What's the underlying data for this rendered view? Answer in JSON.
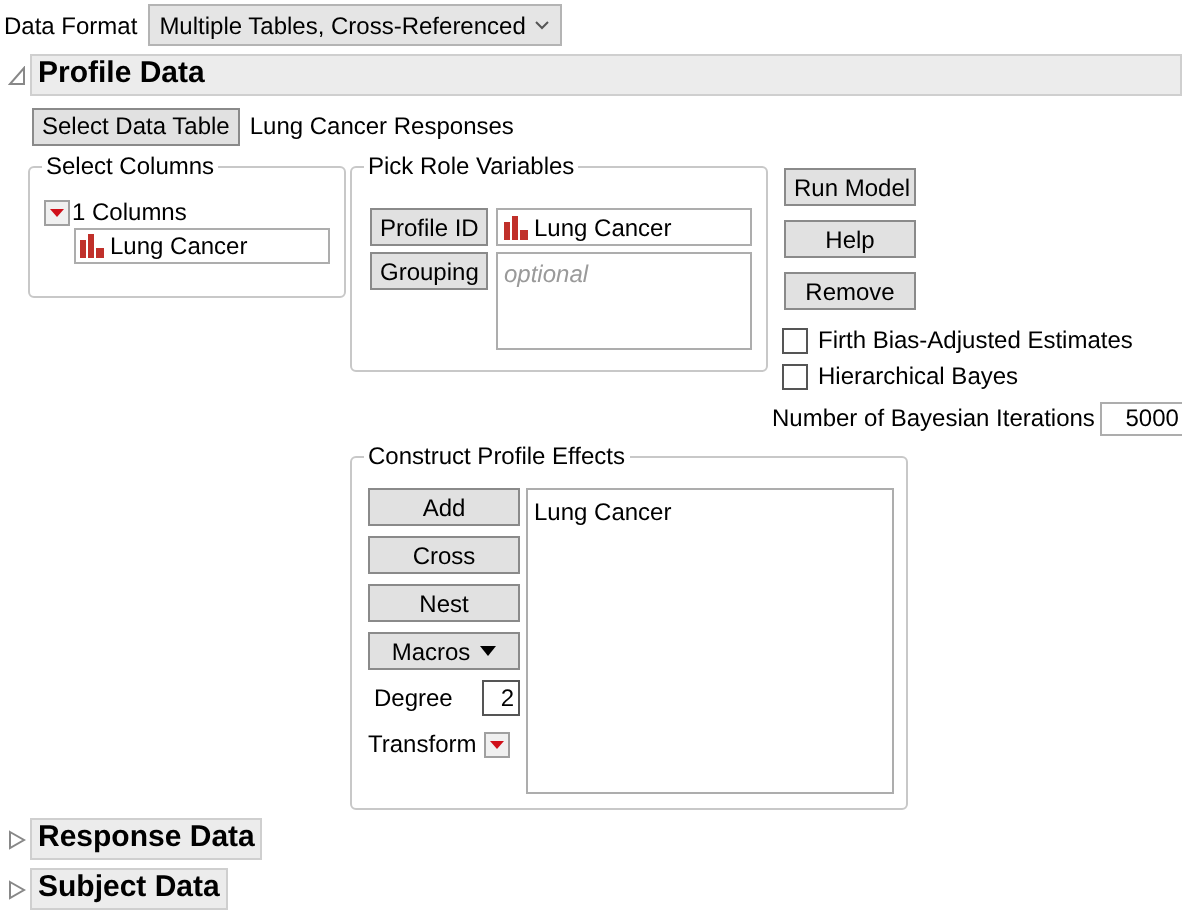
{
  "data_format": {
    "label": "Data Format",
    "value": "Multiple Tables, Cross-Referenced"
  },
  "sections": [
    {
      "title": "Profile Data",
      "expanded": true
    },
    {
      "title": "Response Data",
      "expanded": false
    },
    {
      "title": "Subject Data",
      "expanded": false
    }
  ],
  "profile_data": {
    "select_button": "Select Data Table",
    "table_name": "Lung Cancer Responses",
    "select_columns": {
      "title": "Select Columns",
      "count": "1 Columns",
      "columns": [
        "Lung Cancer"
      ]
    },
    "pick_roles": {
      "title": "Pick Role Variables",
      "roles": [
        {
          "button": "Profile ID",
          "value": "Lung Cancer"
        },
        {
          "button": "Grouping",
          "placeholder": "optional"
        }
      ]
    },
    "actions": [
      "Run Model",
      "Help",
      "Remove"
    ],
    "options": [
      {
        "label": "Firth Bias-Adjusted Estimates",
        "checked": false
      },
      {
        "label": "Hierarchical Bayes",
        "checked": false
      }
    ],
    "iterations": {
      "label": "Number of Bayesian Iterations",
      "value": "5000"
    },
    "construct": {
      "title": "Construct Profile Effects",
      "buttons": [
        {
          "label": "Add",
          "kind": "plain"
        },
        {
          "label": "Cross",
          "kind": "plain"
        },
        {
          "label": "Nest",
          "kind": "plain"
        },
        {
          "label": "Macros",
          "kind": "menu"
        }
      ],
      "degree": {
        "label": "Degree",
        "value": "2"
      },
      "transform": {
        "label": "Transform"
      },
      "effects": [
        "Lung Cancer"
      ]
    }
  }
}
